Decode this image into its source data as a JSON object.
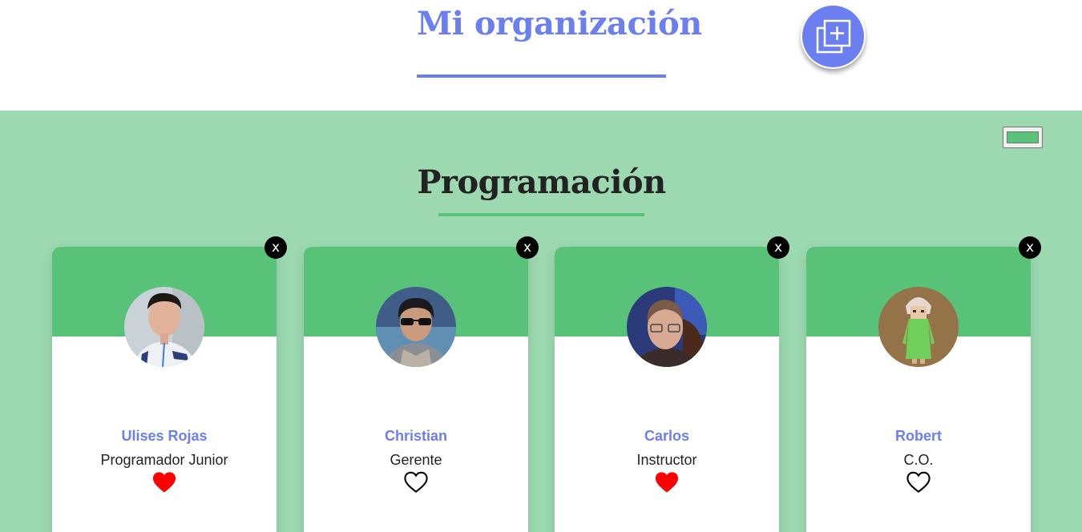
{
  "header": {
    "title": "Mi organización",
    "add_button_icon": "add-copy-icon",
    "accent_color": "#6b7ff0"
  },
  "team": {
    "title": "Programación",
    "primary_color": "#57c278",
    "secondary_color": "#9cd9b0",
    "color_input_value": "#57c278",
    "delete_icon": "x",
    "members": [
      {
        "name": "Ulises Rojas",
        "role": "Programador Junior",
        "favorite": true
      },
      {
        "name": "Christian",
        "role": "Gerente",
        "favorite": false
      },
      {
        "name": "Carlos",
        "role": "Instructor",
        "favorite": true
      },
      {
        "name": "Robert",
        "role": "C.O.",
        "favorite": false
      }
    ]
  }
}
